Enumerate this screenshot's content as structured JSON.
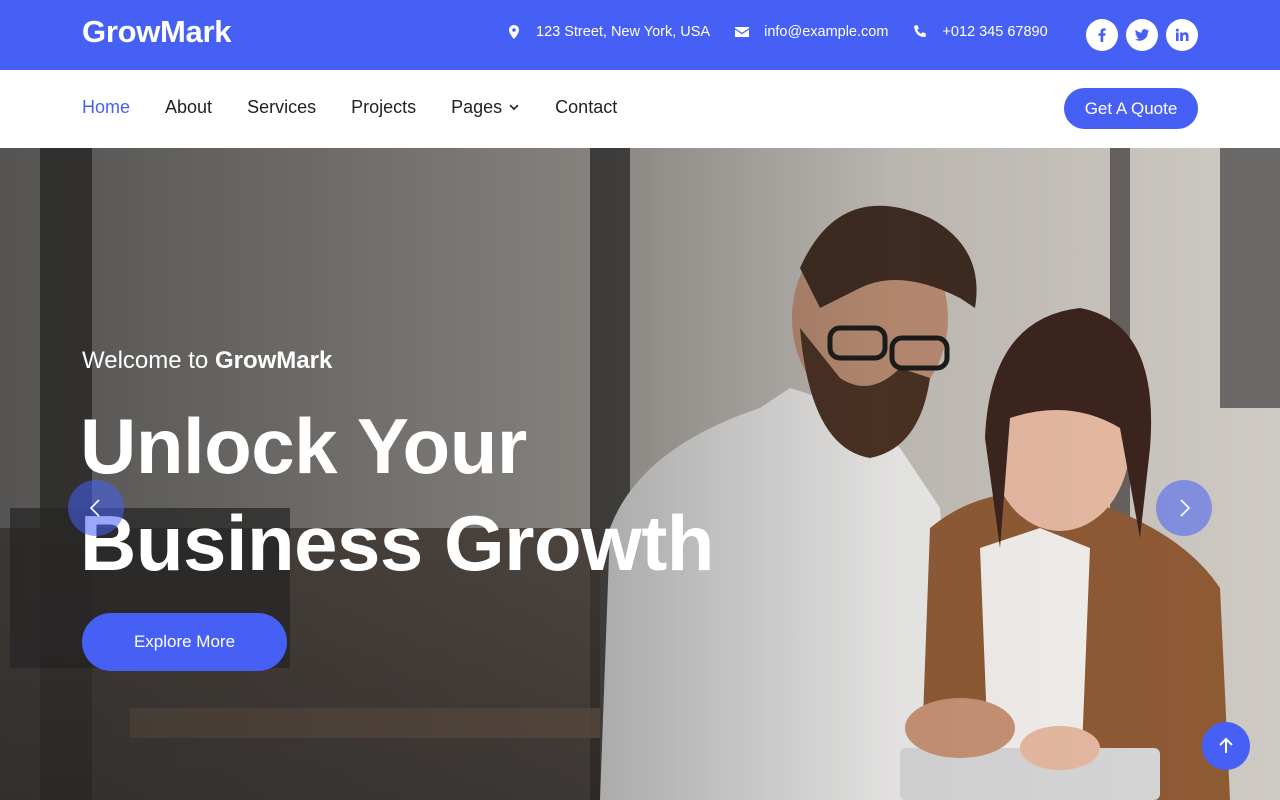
{
  "brand": "GrowMark",
  "topbar": {
    "address": "123 Street, New York, USA",
    "email": "info@example.com",
    "phone": "+012 345 67890",
    "socials": [
      {
        "icon": "facebook-icon",
        "label": "f"
      },
      {
        "icon": "twitter-icon",
        "label": "t"
      },
      {
        "icon": "linkedin-icon",
        "label": "in"
      }
    ]
  },
  "nav": {
    "items": [
      "Home",
      "About",
      "Services",
      "Projects",
      "Pages",
      "Contact"
    ],
    "active": "Home",
    "cta": "Get A Quote"
  },
  "hero": {
    "welcome_prefix": "Welcome to",
    "welcome_brand": "GrowMark",
    "headline_line1": "Unlock Your",
    "headline_line2": "Business Growth",
    "cta": "Explore More"
  },
  "colors": {
    "primary": "#4660f5",
    "white": "#ffffff",
    "text": "#222222"
  }
}
